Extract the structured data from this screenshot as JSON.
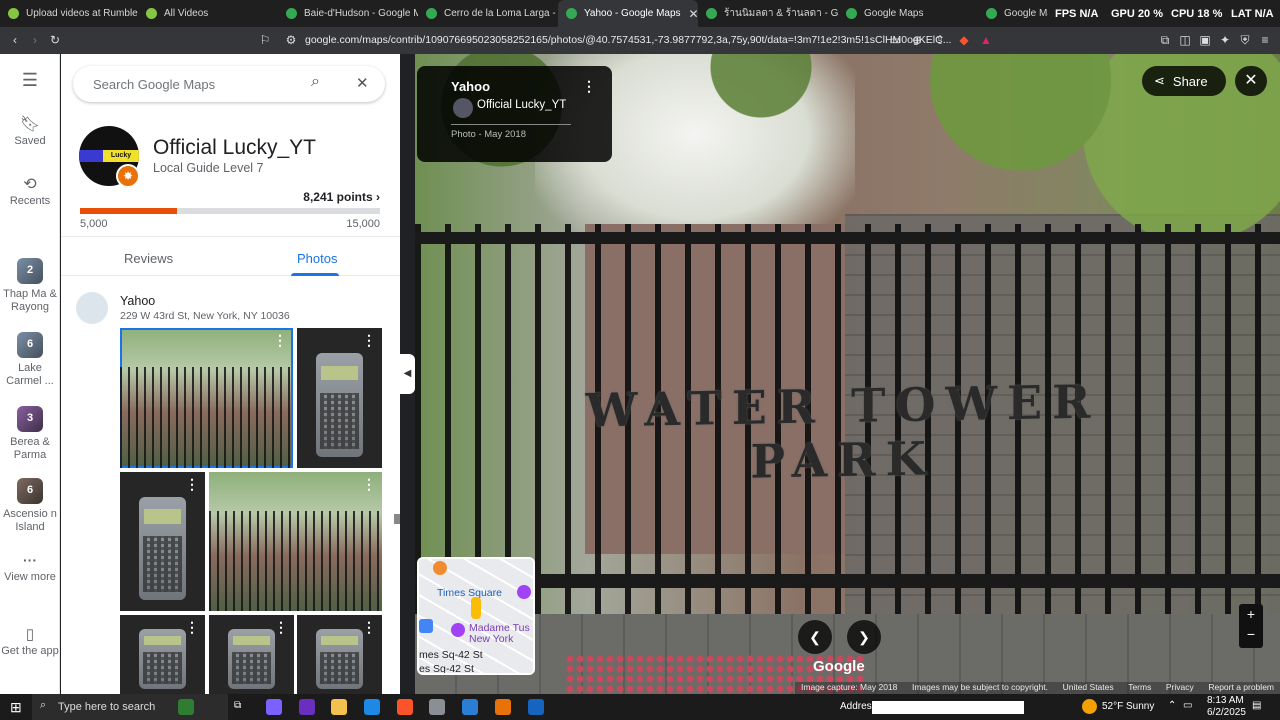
{
  "tabs": [
    {
      "title": "Upload videos at Rumble",
      "color": "#85c742"
    },
    {
      "title": "All Videos",
      "color": "#85c742"
    },
    {
      "title": "Baie-d'Hudson - Google Maps",
      "color": "#34a853"
    },
    {
      "title": "Cerro de la Loma Larga - Goo",
      "color": "#34a853"
    },
    {
      "title": "Yahoo - Google Maps",
      "color": "#34a853",
      "active": true
    },
    {
      "title": "ร้านนิมลดา & ร้านลดา - Google",
      "color": "#34a853"
    },
    {
      "title": "Google Maps",
      "color": "#34a853"
    },
    {
      "title": "Google Maps",
      "color": "#34a853"
    }
  ],
  "perf": {
    "fps_label": "FPS",
    "fps": "N/A",
    "gpu_label": "GPU",
    "gpu": "20 %",
    "cpu_label": "CPU",
    "cpu": "18 %",
    "lat_label": "LAT",
    "lat": "N/A"
  },
  "url": "google.com/maps/contrib/109076695023058252165/photos/@40.7574531,-73.9877792,3a,75y,90t/data=!3m7!1e2!3m5!1sClHM0ogKElC...",
  "rail": {
    "menu_icon": "hamburger-icon",
    "saved": "Saved",
    "recents": "Recents",
    "recent_places": [
      {
        "count": "2",
        "name": "Thap Ma & Rayong"
      },
      {
        "count": "6",
        "name": "Lake Carmel ..."
      },
      {
        "count": "3",
        "name": "Berea & Parma"
      },
      {
        "count": "6",
        "name": "Ascensio n Island"
      }
    ],
    "view_more": "View more",
    "get_app": "Get the app"
  },
  "panel": {
    "search_placeholder": "Search Google Maps",
    "profile_name": "Official Lucky_YT",
    "avatar_text": "Lucky",
    "level": "Local Guide Level 7",
    "points": "8,241 points",
    "points_progress": 0.3241,
    "points_min": "5,000",
    "points_max": "15,000",
    "tab_reviews": "Reviews",
    "tab_photos": "Photos",
    "place_name": "Yahoo",
    "place_address": "229 W 43rd St, New York, NY 10036"
  },
  "viewer": {
    "place": "Yahoo",
    "user": "Official Lucky_YT",
    "date": "Photo - May 2018",
    "share": "Share",
    "sign_text": "WATER TOWER PARK",
    "minimap": {
      "times_square": "Times Square",
      "madame": "Madame Tus New York",
      "street": "mes Sq-42 St",
      "street2": "es Sq-42 St"
    },
    "google": "Google",
    "attribution": [
      "Image capture: May 2018",
      "Images may be subject to copyright.",
      "United States",
      "Terms",
      "Privacy",
      "Report a problem"
    ]
  },
  "taskbar": {
    "search": "Type here to search",
    "address_label": "Address",
    "weather": "52°F  Sunny",
    "time": "8:13 AM",
    "date": "6/2/2025"
  }
}
